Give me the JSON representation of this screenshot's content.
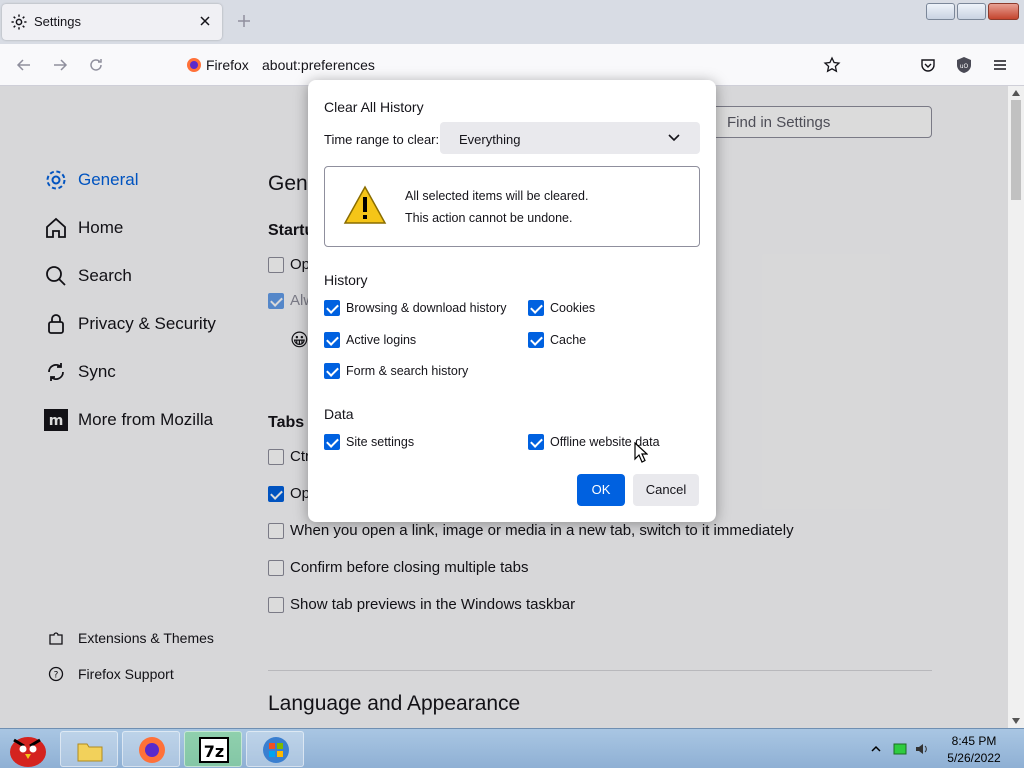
{
  "browser": {
    "tab_title": "Settings",
    "identity": "Firefox",
    "url": "about:preferences"
  },
  "sidebar": {
    "items": [
      {
        "label": "General",
        "icon": "gear-icon",
        "active": true
      },
      {
        "label": "Home",
        "icon": "home-icon"
      },
      {
        "label": "Search",
        "icon": "search-icon"
      },
      {
        "label": "Privacy & Security",
        "icon": "lock-icon"
      },
      {
        "label": "Sync",
        "icon": "sync-icon"
      },
      {
        "label": "More from Mozilla",
        "icon": "mozilla-icon"
      }
    ],
    "footer": [
      {
        "label": "Extensions & Themes",
        "icon": "puzzle-icon"
      },
      {
        "label": "Firefox Support",
        "icon": "help-icon"
      }
    ]
  },
  "main": {
    "find_placeholder": "Find in Settings",
    "general_heading": "Gene",
    "startup_heading": "Startu",
    "startup_opt1": "Op",
    "startup_opt2": "Alw",
    "tabs_heading": "Tabs",
    "tabs_opt1": "Ctr",
    "tabs_opt2": "Op",
    "tabs_opt3": "When you open a link, image or media in a new tab, switch to it immediately",
    "tabs_opt4": "Confirm before closing multiple tabs",
    "tabs_opt5": "Show tab previews in the Windows taskbar",
    "language_heading": "Language and Appearance"
  },
  "dialog": {
    "title": "Clear All History",
    "range_label": "Time range to clear:",
    "range_value": "Everything",
    "warning_line1": "All selected items will be cleared.",
    "warning_line2": "This action cannot be undone.",
    "history_heading": "History",
    "history_items": [
      {
        "label": "Browsing & download history",
        "checked": true
      },
      {
        "label": "Cookies",
        "checked": true
      },
      {
        "label": "Active logins",
        "checked": true
      },
      {
        "label": "Cache",
        "checked": true
      },
      {
        "label": "Form & search history",
        "checked": true
      }
    ],
    "data_heading": "Data",
    "data_items": [
      {
        "label": "Site settings",
        "checked": true
      },
      {
        "label": "Offline website data",
        "checked": true
      }
    ],
    "ok_label": "OK",
    "cancel_label": "Cancel"
  },
  "taskbar": {
    "time": "8:45 PM",
    "date": "5/26/2022"
  },
  "colors": {
    "accent": "#0061e0",
    "button_secondary": "#e9e9ed"
  }
}
